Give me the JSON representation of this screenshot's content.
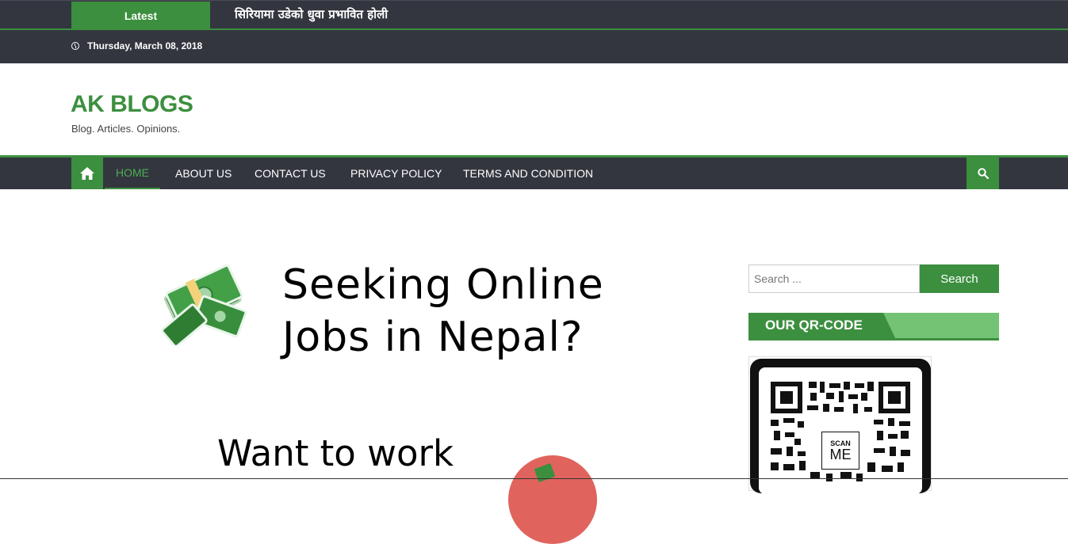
{
  "latest": {
    "label": "Latest",
    "headline": "सिरियामा उडेको धुवा प्रभावित होली"
  },
  "topbar": {
    "date": "Thursday, March 08, 2018"
  },
  "branding": {
    "title": "AK BLOGS",
    "tagline": "Blog. Articles. Opinions."
  },
  "nav": {
    "items": [
      {
        "label": "HOME"
      },
      {
        "label": "ABOUT US"
      },
      {
        "label": "CONTACT US"
      },
      {
        "label": "PRIVACY POLICY"
      },
      {
        "label": "TERMS AND CONDITION"
      }
    ]
  },
  "hero": {
    "line1": "Seeking Online",
    "line2": "Jobs in Nepal?",
    "subline": "Want to work"
  },
  "sidebar": {
    "search_placeholder": "Search ...",
    "search_button": "Search",
    "qr_widget_title": "OUR QR-CODE",
    "qr_badge_top": "SCAN",
    "qr_badge_bottom": "ME"
  },
  "colors": {
    "accent": "#3c8f3f",
    "dark_bar": "#33363f",
    "accent_light": "#74c274"
  },
  "icons": {
    "home": "home-icon",
    "search": "search-icon",
    "clock": "clock-icon",
    "money": "money-stack-icon"
  }
}
